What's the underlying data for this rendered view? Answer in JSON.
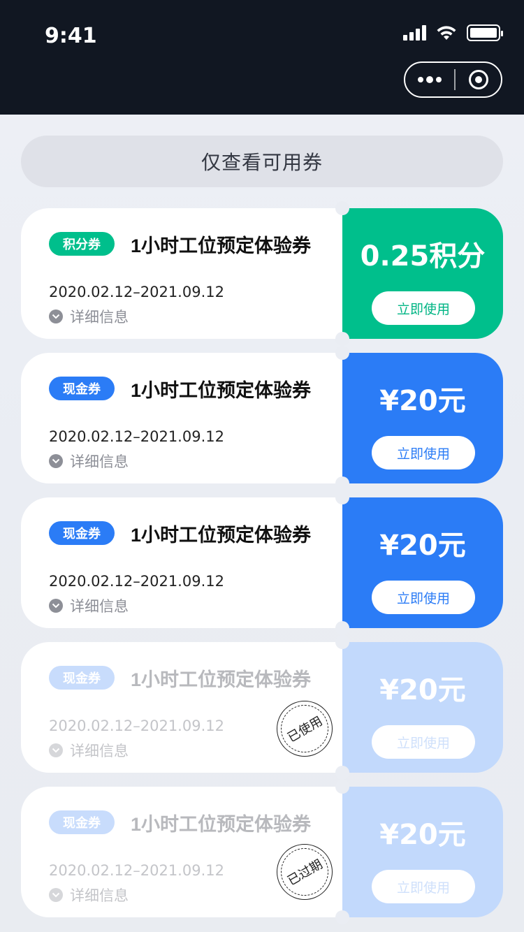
{
  "status_bar": {
    "time": "9:41"
  },
  "capsule": {
    "more_icon": "more-dots-icon",
    "close_icon": "target-close-icon"
  },
  "filter": {
    "label": "仅查看可用券"
  },
  "coupons": [
    {
      "tag": "积分券",
      "title": "1小时工位预定体验券",
      "date": "2020.02.12–2021.09.12",
      "details": "详细信息",
      "amount": "0.25积分",
      "button": "立即使用",
      "state": "available",
      "color": "#00bf8c"
    },
    {
      "tag": "现金券",
      "title": "1小时工位预定体验券",
      "date": "2020.02.12–2021.09.12",
      "details": "详细信息",
      "amount": "¥20元",
      "button": "立即使用",
      "state": "available",
      "color": "#2b7cf6"
    },
    {
      "tag": "现金券",
      "title": "1小时工位预定体验券",
      "date": "2020.02.12–2021.09.12",
      "details": "详细信息",
      "amount": "¥20元",
      "button": "立即使用",
      "state": "available",
      "color": "#2b7cf6"
    },
    {
      "tag": "现金券",
      "title": "1小时工位预定体验券",
      "date": "2020.02.12–2021.09.12",
      "details": "详细信息",
      "amount": "¥20元",
      "button": "立即使用",
      "state": "used",
      "stamp": "已使用",
      "color": "#c2d9fc"
    },
    {
      "tag": "现金券",
      "title": "1小时工位预定体验券",
      "date": "2020.02.12–2021.09.12",
      "details": "详细信息",
      "amount": "¥20元",
      "button": "立即使用",
      "state": "expired",
      "stamp": "已过期",
      "color": "#c2d9fc"
    }
  ]
}
